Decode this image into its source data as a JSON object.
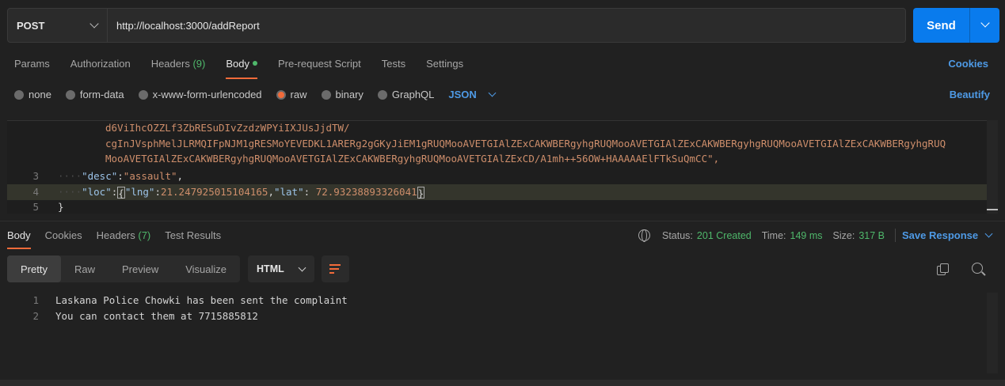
{
  "request": {
    "method": "POST",
    "url": "http://localhost:3000/addReport",
    "send_label": "Send"
  },
  "request_tabs": [
    {
      "label": "Params"
    },
    {
      "label": "Authorization"
    },
    {
      "label": "Headers",
      "count": "(9)"
    },
    {
      "label": "Body",
      "active": true
    },
    {
      "label": "Pre-request Script"
    },
    {
      "label": "Tests"
    },
    {
      "label": "Settings"
    }
  ],
  "cookies_label": "Cookies",
  "body_types": [
    "none",
    "form-data",
    "x-www-form-urlencoded",
    "raw",
    "binary",
    "GraphQL"
  ],
  "selected_body_type": "raw",
  "body_format": "JSON",
  "beautify_label": "Beautify",
  "editor": {
    "wrapped_lines": [
      "d6ViIhcOZZLf3ZbRESuDIvZzdzWPYiIXJUsJjdTW/",
      "cgInJVsphMelJLRMQIFpNJM1gRESMoYEVEDKL1ARERg2gGKyJiEM1gRUQMooAVETGIAlZExCAKWBERgyhgRUQMooAVETGIAlZExCAKWBERgyhgRUQMooAVETGIAlZExCAKWBERgyhgRUQ",
      "MooAVETGIAlZExCAKWBERgyhgRUQMooAVETGIAlZExCAKWBERgyhgRUQMooAVETGIAlZExCD/A1mh++56OW+HAAAAAElFTkSuQmCC\","
    ],
    "line3": {
      "num": "3",
      "key": "\"desc\"",
      "value": "\"assault\""
    },
    "line4": {
      "num": "4",
      "key": "\"loc\"",
      "lng_key": "\"lng\"",
      "lng_val": "21.247925015104165",
      "lat_key": "\"lat\"",
      "lat_val": "72.93238893326041"
    },
    "line5": {
      "num": "5",
      "text": "}"
    }
  },
  "response_tabs": [
    {
      "label": "Body",
      "active": true
    },
    {
      "label": "Cookies"
    },
    {
      "label": "Headers",
      "count": "(7)"
    },
    {
      "label": "Test Results"
    }
  ],
  "response_status": {
    "status_label": "Status:",
    "status_value": "201 Created",
    "time_label": "Time:",
    "time_value": "149 ms",
    "size_label": "Size:",
    "size_value": "317 B",
    "save_label": "Save Response"
  },
  "view_modes": [
    "Pretty",
    "Raw",
    "Preview",
    "Visualize"
  ],
  "active_view_mode": "Pretty",
  "response_format": "HTML",
  "response_lines": [
    {
      "num": "1",
      "text": "Laskana Police Chowki has been sent the complaint"
    },
    {
      "num": "2",
      "text": "You can contact them at 7715885812"
    }
  ],
  "colors": {
    "accent": "#097bed",
    "link": "#4e9ae6",
    "active_tab": "#f26b3a",
    "success": "#4fb86b",
    "string": "#ce8e6b"
  },
  "icons": [
    "chevron-down-icon",
    "globe-icon",
    "copy-icon",
    "search-icon",
    "wrap-lines-icon"
  ]
}
